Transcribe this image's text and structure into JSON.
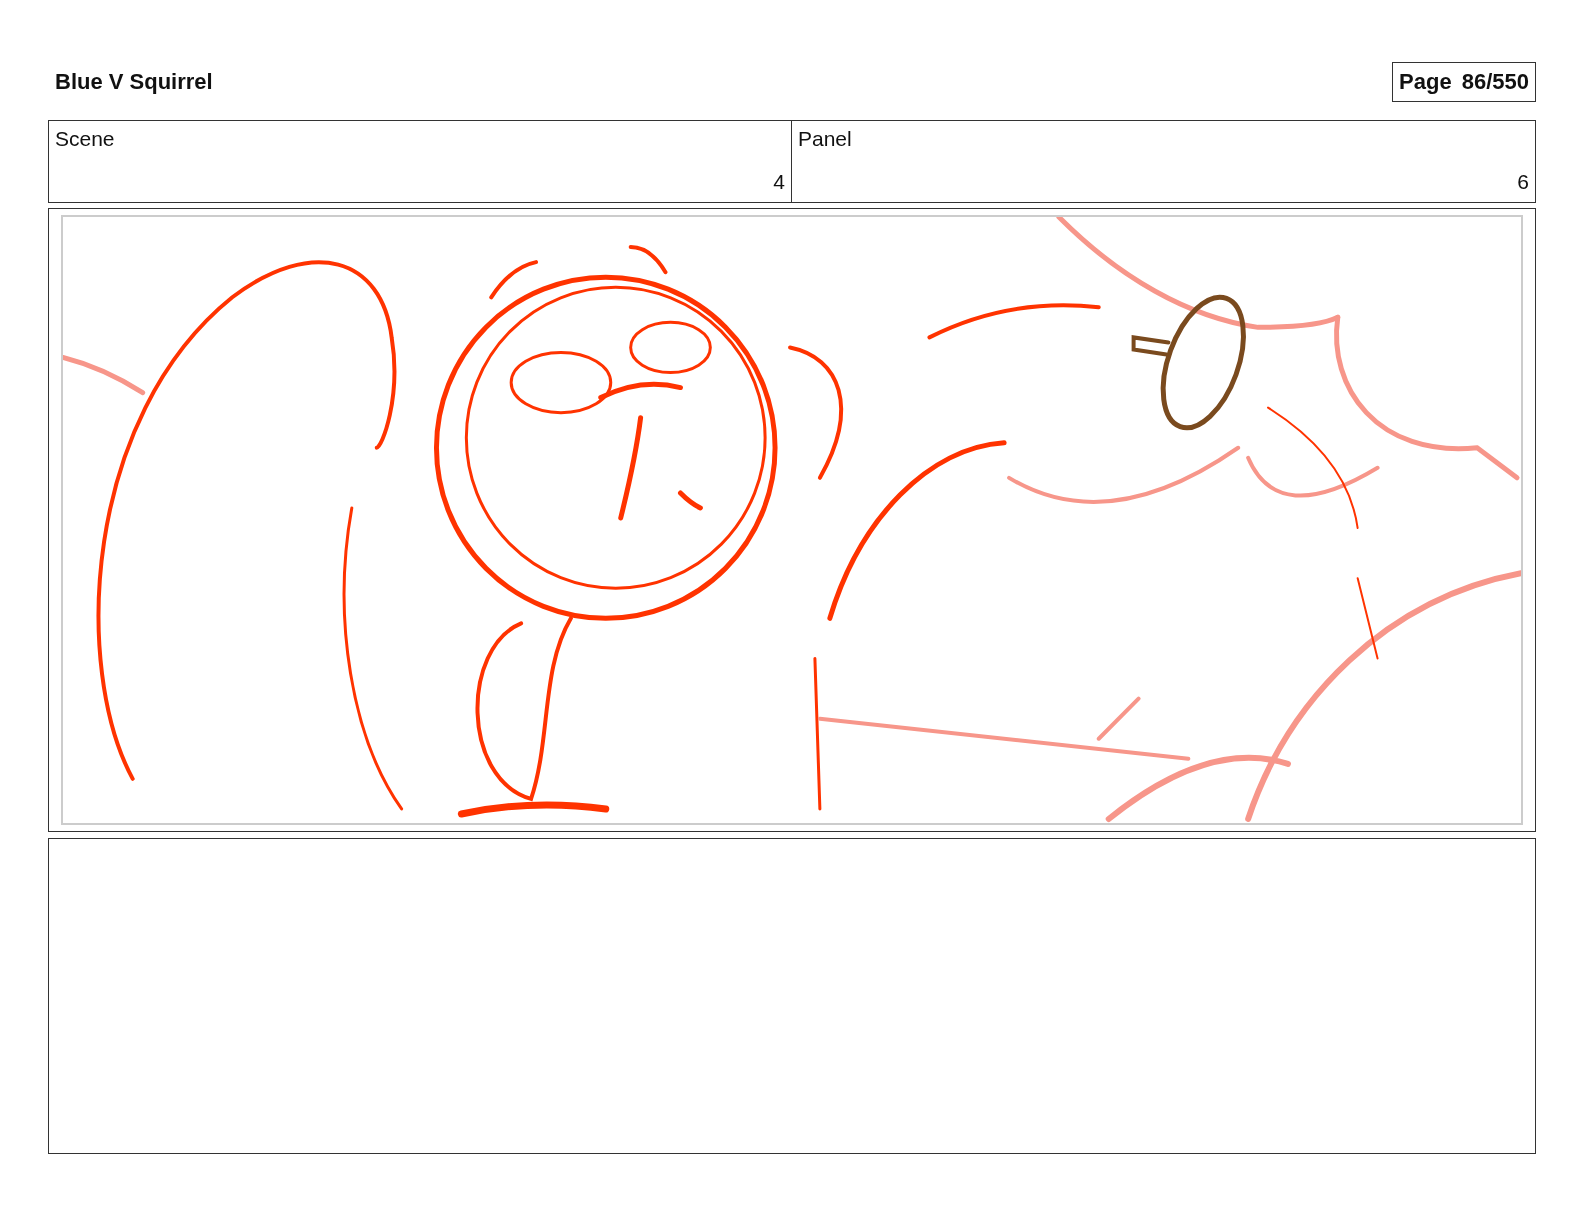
{
  "title": "Blue V Squirrel",
  "page": {
    "label": "Page",
    "number": "86/550"
  },
  "fields": [
    {
      "heading": "Scene",
      "number": "4"
    },
    {
      "heading": "Panel",
      "number": "6"
    }
  ],
  "panel": {
    "kind": "sketch"
  }
}
